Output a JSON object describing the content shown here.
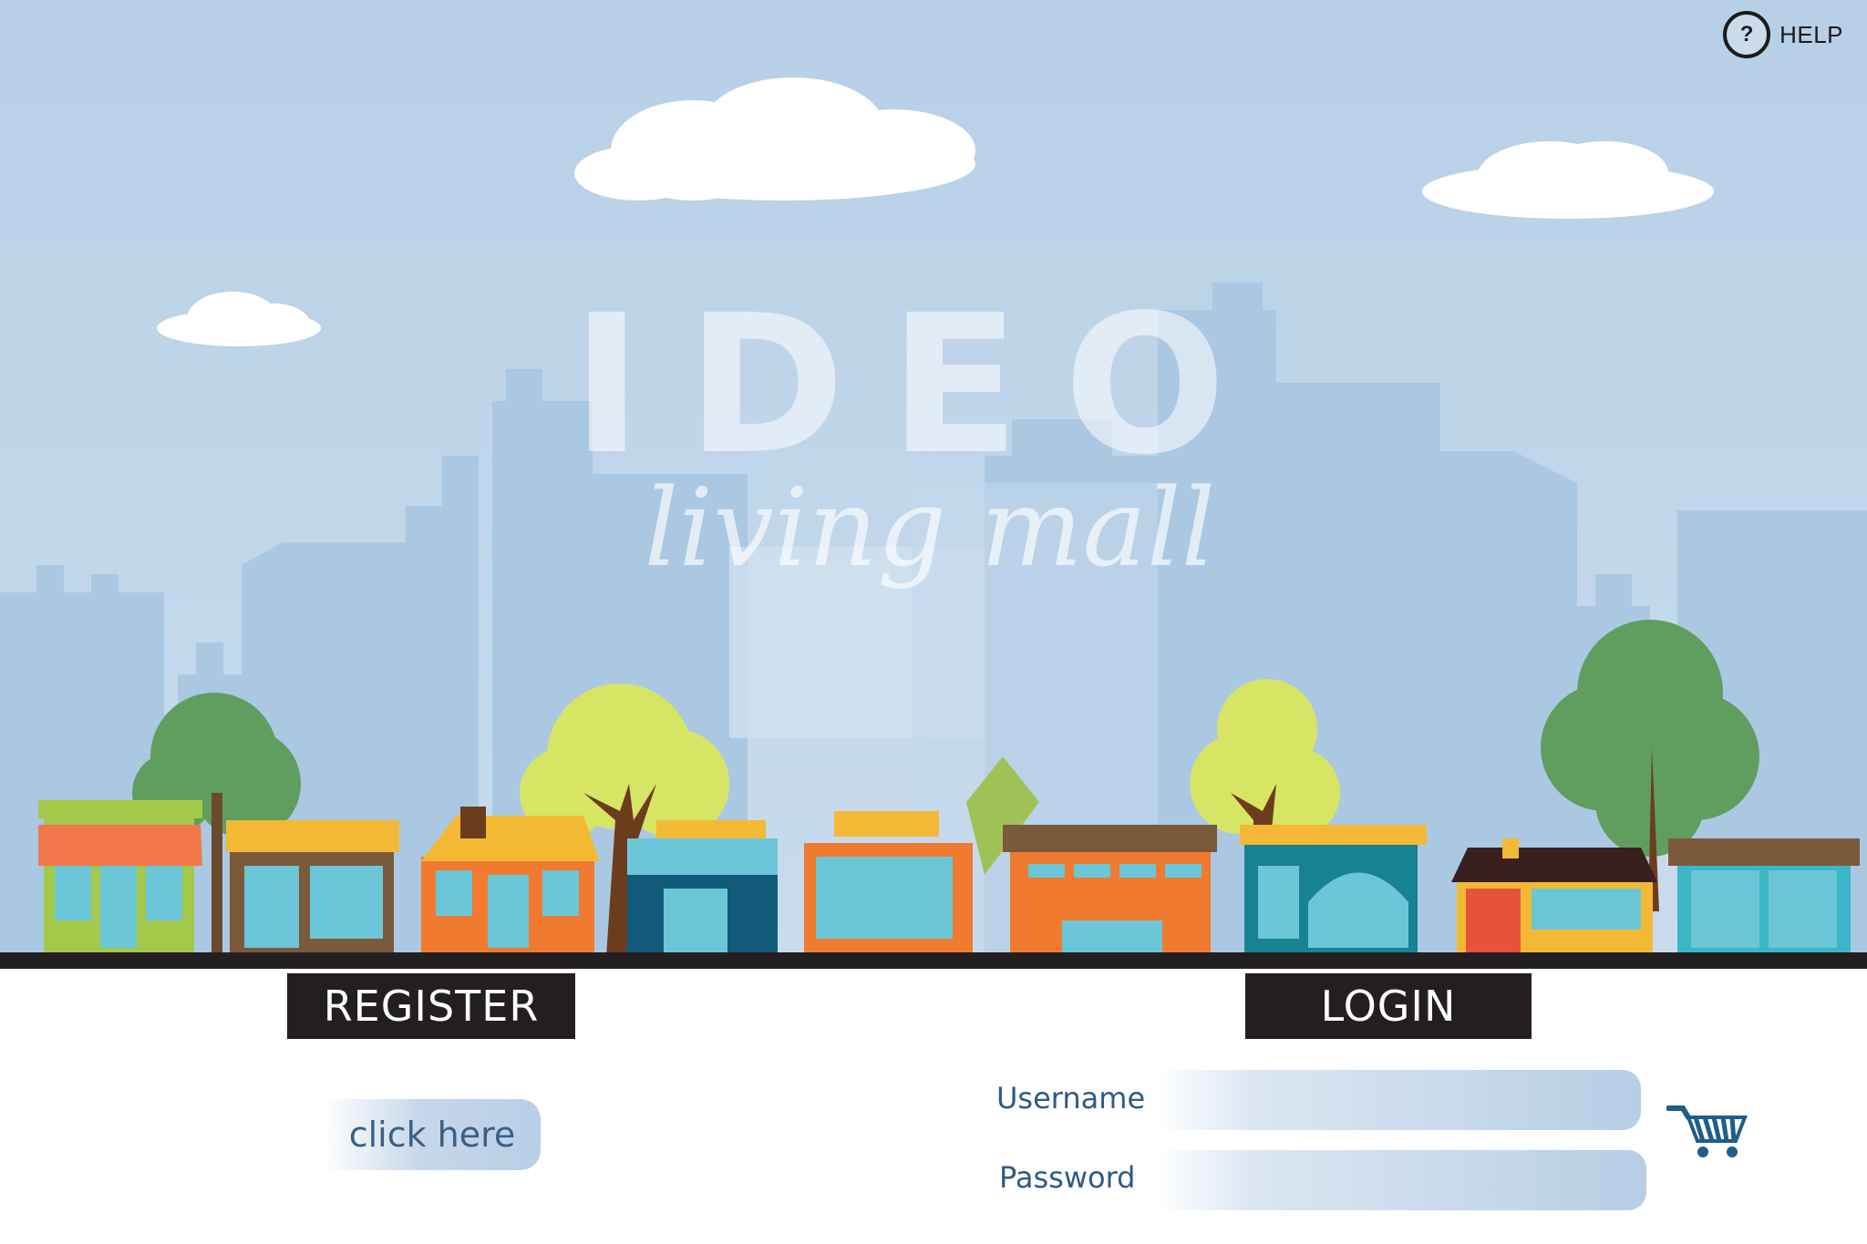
{
  "help": {
    "label": "HELP",
    "icon": "question-circle-icon",
    "glyph": "?"
  },
  "brand": {
    "logo_text": "IDEO",
    "tagline": "living mall"
  },
  "register": {
    "tab_label": "REGISTER",
    "link_label": "click here"
  },
  "login": {
    "tab_label": "LOGIN",
    "username_label": "Username",
    "password_label": "Password",
    "username_value": "",
    "password_value": "",
    "submit_icon": "shopping-cart-icon"
  },
  "colors": {
    "sky": "#b7d1e6",
    "skyline": "#a9c8e2",
    "tab_bg": "#231f20",
    "label_text": "#2e5a86",
    "cart": "#1f5d8a"
  }
}
